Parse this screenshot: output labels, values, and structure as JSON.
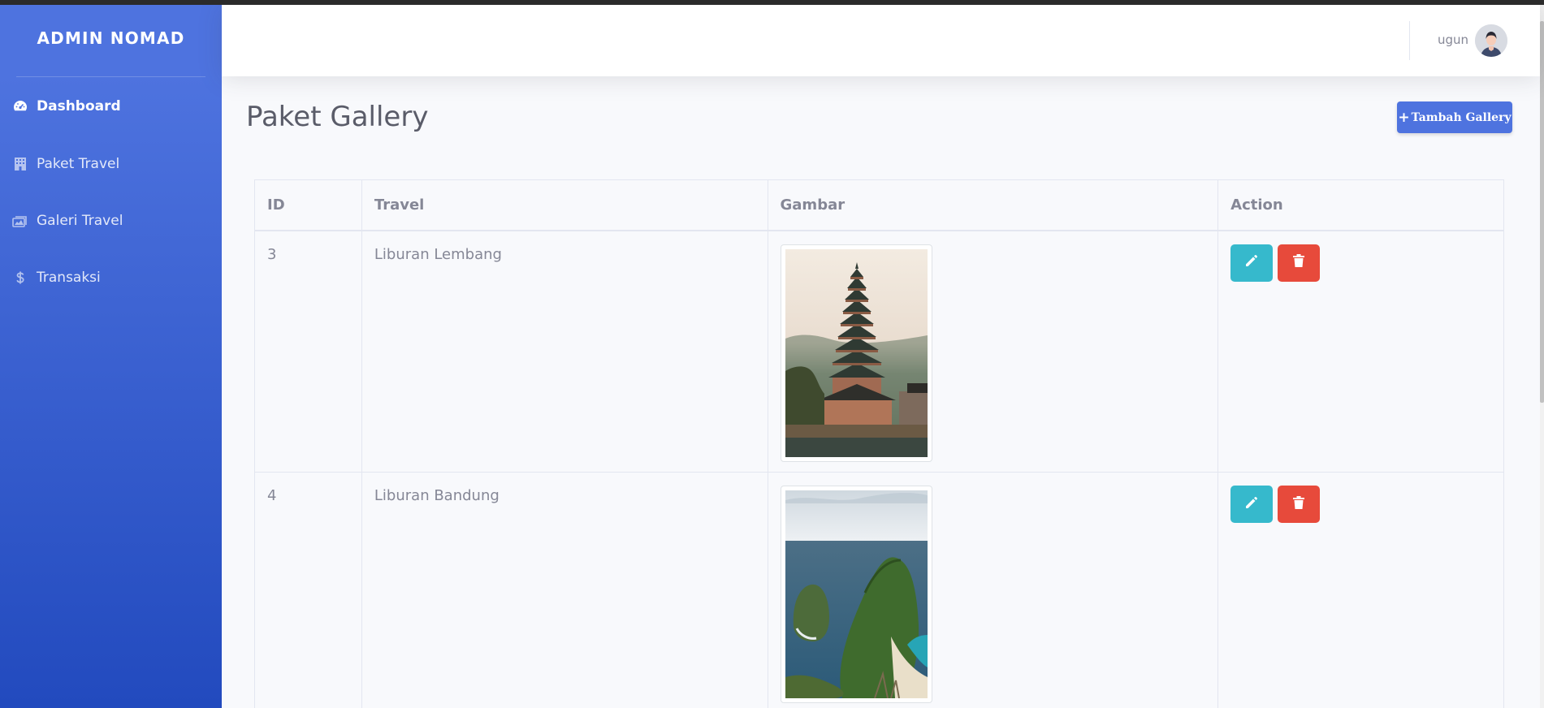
{
  "sidebar": {
    "brand": "ADMIN NOMAD",
    "items": [
      {
        "label": "Dashboard",
        "icon": "tachometer-icon",
        "active": true
      },
      {
        "label": "Paket Travel",
        "icon": "building-icon",
        "active": false
      },
      {
        "label": "Galeri Travel",
        "icon": "images-icon",
        "active": false
      },
      {
        "label": "Transaksi",
        "icon": "dollar-icon",
        "active": false
      }
    ]
  },
  "topbar": {
    "username": "ugun"
  },
  "page": {
    "title": "Paket Gallery",
    "add_button_label": "Tambah Gallery"
  },
  "table": {
    "headers": [
      "ID",
      "Travel",
      "Gambar",
      "Action"
    ],
    "rows": [
      {
        "id": "3",
        "travel": "Liburan Lembang",
        "image": "pagoda-temple-photo"
      },
      {
        "id": "4",
        "travel": "Liburan Bandung",
        "image": "sea-cliff-photo"
      }
    ]
  },
  "colors": {
    "primary": "#4e73df",
    "info": "#36b9cc",
    "danger": "#e74a3b"
  }
}
